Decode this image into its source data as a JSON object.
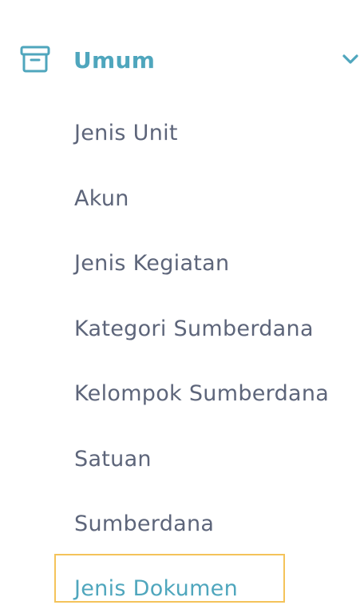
{
  "colors": {
    "accent": "#4fa6bd",
    "text": "#5d657a",
    "highlight_border": "#f4c35a",
    "background": "#ffffff"
  },
  "group": {
    "label": "Umum",
    "icon": "archive-icon",
    "expand_icon": "chevron-down-icon",
    "expanded": true
  },
  "submenu": {
    "items": [
      {
        "label": "Jenis Unit",
        "active": false
      },
      {
        "label": "Akun",
        "active": false
      },
      {
        "label": "Jenis Kegiatan",
        "active": false
      },
      {
        "label": "Kategori Sumberdana",
        "active": false
      },
      {
        "label": "Kelompok Sumberdana",
        "active": false
      },
      {
        "label": "Satuan",
        "active": false
      },
      {
        "label": "Sumberdana",
        "active": false
      },
      {
        "label": "Jenis Dokumen",
        "active": true
      }
    ]
  }
}
